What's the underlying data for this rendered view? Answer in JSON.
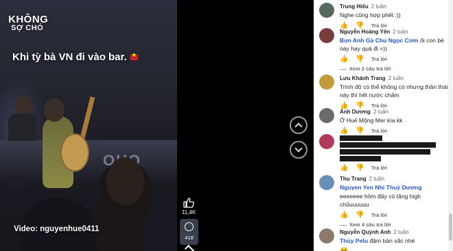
{
  "video": {
    "logo_main": "KHÔNG",
    "logo_sub": "SỢ CHÓ",
    "caption": "Khi tỳ bà VN đi vào bar.",
    "stage_text": "OHO",
    "credit": "Video: nguyenhue0411"
  },
  "actions": {
    "like_count": "11,4K",
    "comment_count": "418"
  },
  "comments": [
    {
      "name": "Trung Hiếu",
      "time": "2 tuần",
      "text": "Nghe cũng hợp phết :))",
      "reply_label": "Trả lời",
      "avatar_color": "#556b5e"
    },
    {
      "name": "Nguyễn Hoàng Yến",
      "time": "2 tuần",
      "mention": "Bon Anh Gà Chu Ngọc Cơm",
      "text": " ôi con bé này hay quá đi =))",
      "reply_label": "Trả lời",
      "replies_label": "Xem 2 câu trả lời",
      "avatar_color": "#7a3b3b"
    },
    {
      "name": "Lưu Khánh Trang",
      "time": "2 tuần",
      "text": "Trình độ có thể không có nhưng thần thái này thì hết nước chấm",
      "reply_label": "Trả lời",
      "avatar_color": "#c49a3a"
    },
    {
      "name": "Ánh Dương",
      "time": "2 tuần",
      "text": "Ở Huế Mộng Mer kìa kk",
      "reply_label": "Trả lời",
      "avatar_color": "#6b6b6b"
    },
    {
      "name": "",
      "time": "",
      "text": "",
      "reply_label": "Trả lời",
      "avatar_color": "#b03a5a"
    },
    {
      "name": "Thu Trang",
      "time": "2 tuần",
      "mention": "Nguyen Yen Nhi Thuỳ Dương",
      "text": "eeeeeee hôm đấy có tăng high chũuuuuuu",
      "reply_label": "Trả lời",
      "replies_label": "Xem 4 câu trả lời",
      "avatar_color": "#6a8fb5"
    },
    {
      "name": "Nguyễn Quỳnh Anh",
      "time": "2 tuần",
      "mention": "Thùy Pelu",
      "text": " đậm bản sắc nhé",
      "avatar_color": "#8a7a6a"
    }
  ]
}
